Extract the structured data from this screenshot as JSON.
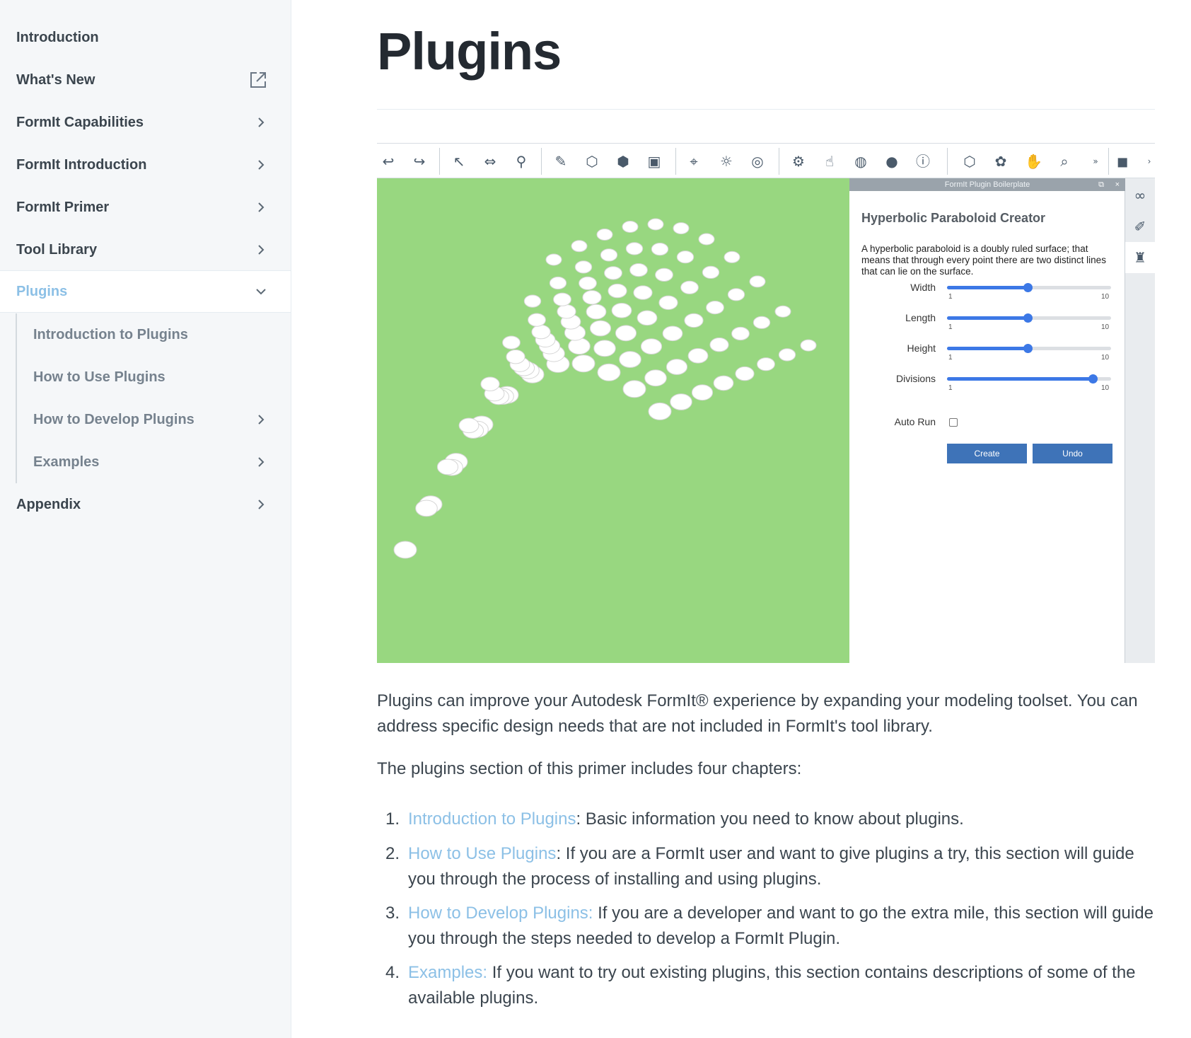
{
  "sidebar": {
    "items": [
      {
        "label": "Introduction"
      },
      {
        "label": "What's New"
      },
      {
        "label": "FormIt Capabilities"
      },
      {
        "label": "FormIt Introduction"
      },
      {
        "label": "FormIt Primer"
      },
      {
        "label": "Tool Library"
      },
      {
        "label": "Plugins"
      },
      {
        "label": "Appendix"
      }
    ],
    "plugins_children": [
      {
        "label": "Introduction to Plugins"
      },
      {
        "label": "How to Use Plugins"
      },
      {
        "label": "How to Develop Plugins"
      },
      {
        "label": "Examples"
      }
    ]
  },
  "page": {
    "title": "Plugins"
  },
  "figure": {
    "panel_header": "FormIt Plugin Boilerplate",
    "panel_title": "Hyperbolic Paraboloid Creator",
    "panel_description": "A hyperbolic paraboloid is a doubly ruled surface; that means that through every point there are two distinct lines that can lie on the surface.",
    "sliders": [
      {
        "label": "Width",
        "min": "1",
        "max": "10",
        "value_fraction": 0.49
      },
      {
        "label": "Length",
        "min": "1",
        "max": "10",
        "value_fraction": 0.49
      },
      {
        "label": "Height",
        "min": "1",
        "max": "10",
        "value_fraction": 0.49
      },
      {
        "label": "Divisions",
        "min": "1",
        "max": "10",
        "value_fraction": 0.89
      }
    ],
    "auto_run_label": "Auto Run",
    "auto_run_checked": false,
    "create_label": "Create",
    "undo_label": "Undo",
    "viewport_color": "#98d780",
    "accent_color": "#3c78e6"
  },
  "body": {
    "para1": "Plugins can improve your Autodesk FormIt® experience by expanding your modeling toolset. You can address specific design needs that are not included in FormIt's tool library.",
    "para2": "The plugins section of this primer includes four chapters:",
    "list": [
      {
        "num": "1.",
        "link": "Introduction to Plugins",
        "text": ": Basic information you need to know about plugins."
      },
      {
        "num": "2.",
        "link": "How to Use Plugins",
        "text": ": If you are a FormIt user and want to give plugins a try, this section will guide you through the process of installing and using plugins."
      },
      {
        "num": "3.",
        "link": "How to Develop Plugins:",
        "text": " If you are a developer and want to go the extra mile, this section will guide you through the steps needed to develop a FormIt Plugin."
      },
      {
        "num": "4.",
        "link": "Examples:",
        "text": " If you want to try out existing plugins, this section contains descriptions of some of the available plugins."
      }
    ]
  },
  "colors": {
    "link": "#8cc0e6",
    "text": "#3b454e",
    "sidebar_bg": "#f5f7f9"
  }
}
